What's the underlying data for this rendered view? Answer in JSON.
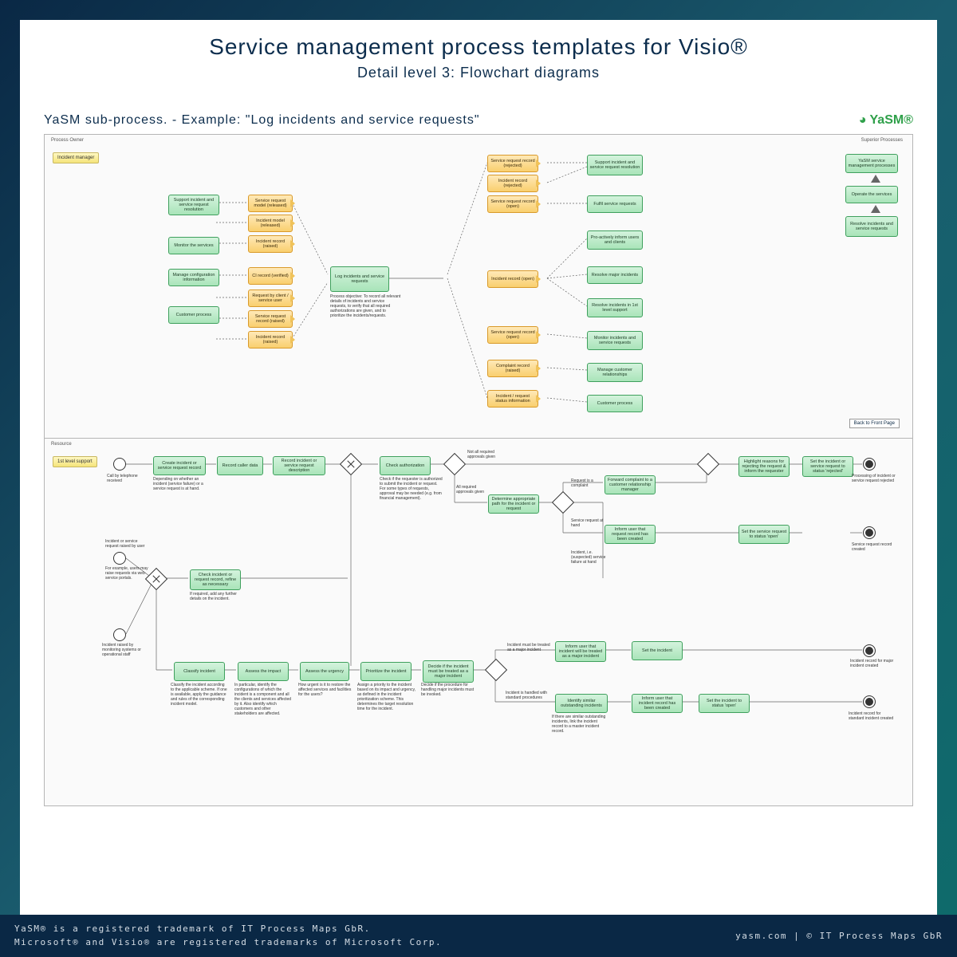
{
  "titles": {
    "main": "Service management process templates for Visio®",
    "sub": "Detail level 3: Flowchart diagrams",
    "subhead": "YaSM sub-process. - Example: \"Log incidents and service requests\"",
    "logo": "YaSM®"
  },
  "panel1": {
    "section": "Process Owner",
    "role": "Incident manager",
    "left_green": [
      "Support incident and service request resolution",
      "Monitor the services",
      "Manage configuration information",
      "Customer process"
    ],
    "left_orange": [
      "Service request model (released)",
      "Incident model (released)",
      "Incident record (raised)",
      "CI record (verified)",
      "Request by client / service user",
      "Service request record (raised)",
      "Incident record (raised)"
    ],
    "center": {
      "label": "Log incidents and service requests",
      "note": "Process objective:\nTo record all relevant details of incidents and service requests, to verify that all required authorizations are given, and to prioritize the incidents/requests."
    },
    "mid_orange": [
      "Service request record (rejected)",
      "Incident record (rejected)",
      "Service request record (open)",
      "Incident record (open)",
      "Service request record (open)",
      "Complaint record (raised)",
      "Incident / request status information"
    ],
    "right_green": [
      "Support incident and service request resolution",
      "Fulfil service requests",
      "Pro-actively inform users and clients",
      "Resolve major incidents",
      "Resolve incidents in 1st level support",
      "Monitor incidents and service requests",
      "Manage customer relationships",
      "Customer process"
    ],
    "superior": {
      "label": "Superior Processes",
      "items": [
        "YaSM service management processes",
        "Operate the services",
        "Resolve incidents and service requests"
      ]
    },
    "back": "Back to Front Page"
  },
  "panel2": {
    "section": "Resource",
    "role": "1st level support",
    "row1": {
      "start_note": "Call by telephone received",
      "b1": "Create incident or service request record",
      "n1": "Depending on whether an incident (service failure) or a service request is at hand.",
      "b2": "Record caller data",
      "b3": "Record incident or service request description",
      "b4": "Check authorization",
      "n4": "Check if the requester is authorized to submit the incident or request. For some types of requests, approval may be needed (e.g. from financial management).",
      "g1": "Not all required approvals given",
      "g2": "All required approvals given",
      "b5": "Determine appropriate path for the incident or request",
      "g3": "Request is a complaint",
      "g4": "Service request at hand",
      "g5": "Incident, i.e. (suspected) service failure at hand",
      "b6": "Forward complaint to a customer relationship manager",
      "b7": "Highlight reasons for rejecting the request & inform the requester",
      "b8": "Set the incident or service request to status 'rejected'",
      "e1": "Processing of incident or service request rejected",
      "b9": "Inform user that request record has been created",
      "b10": "Set the service request to status 'open'",
      "e2": "Service request record created"
    },
    "row2": {
      "start_note": "Incident or service request raised by user",
      "n": "For example, users may raise requests via web service portals.",
      "b1": "Check incident or request record, refine as necessary",
      "n2": "If required, add any further details on the incident.",
      "start2": "Incident raised by monitoring systems or operational staff"
    },
    "row3": {
      "b1": "Classify incident",
      "n1": "Classify the incident according to the applicable scheme. If one is available, apply the guidance and rules of the corresponding incident model.",
      "b2": "Assess the impact",
      "n2": "In particular, identify the configurations of which the incident is a component and all the clients and services affected by it. Also identify which customers and other stakeholders are affected.",
      "b3": "Assess the urgency",
      "n3": "How urgent is it to restore the affected services and facilities for the users?",
      "b4": "Prioritize the incident",
      "n4": "Assign a priority to the incident based on its impact and urgency, as defined in the incident prioritization scheme. This determines the target resolution time for the incident.",
      "b5": "Decide if the incident must be treated as a major incident",
      "n5": "Decide if the procedure for handling major incidents must be invoked.",
      "g1": "Incident must be treated as a major incident",
      "g2": "Incident is handled with standard procedures",
      "b6": "Inform user that incident will be treated as a major incident",
      "b7": "Set the incident",
      "e1": "Incident record for major incident created",
      "b8": "Identify similar outstanding incidents",
      "n8": "If there are similar outstanding incidents, link the incident record to a master incident record.",
      "b9": "Inform user that incident record has been created",
      "b10": "Set the incident to status 'open'",
      "e2": "Incident record for standard incident created"
    }
  },
  "footer": {
    "l1": "YaSM® is a registered trademark of IT Process Maps GbR.",
    "l2": "Microsoft® and Visio® are registered trademarks of Microsoft Corp.",
    "r": "yasm.com | © IT Process Maps GbR"
  }
}
